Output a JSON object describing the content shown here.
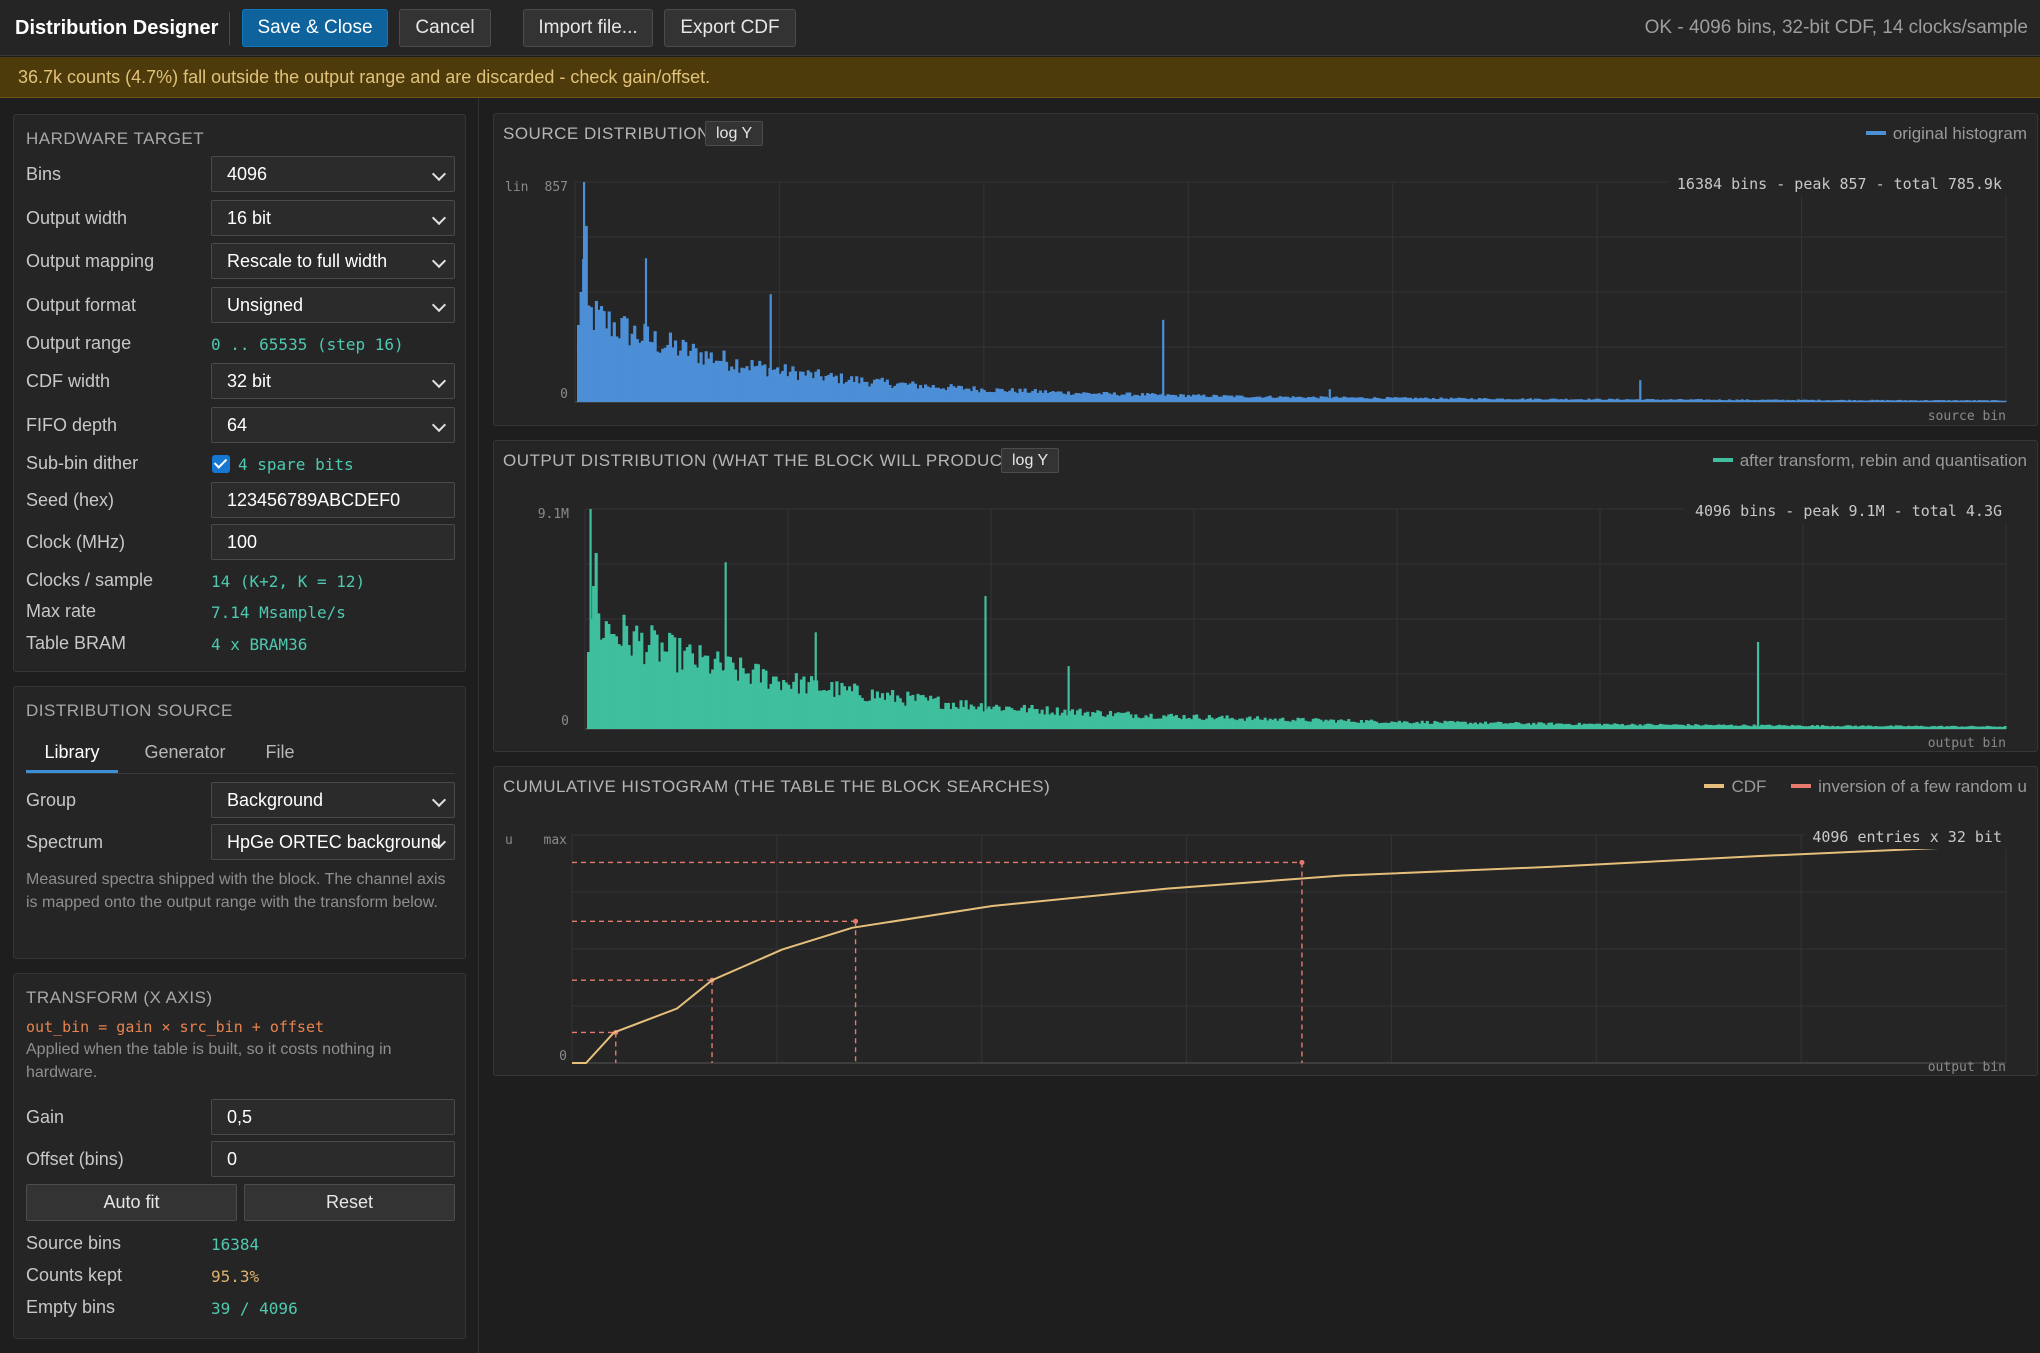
{
  "header": {
    "title": "Distribution Designer",
    "save_label": "Save & Close",
    "cancel_label": "Cancel",
    "import_label": "Import file...",
    "export_label": "Export CDF",
    "status": "OK - 4096 bins, 32-bit CDF, 14 clocks/sample"
  },
  "warning": "36.7k counts (4.7%) fall outside the output range and are discarded - check gain/offset.",
  "hardware": {
    "title": "HARDWARE TARGET",
    "bins_label": "Bins",
    "bins_value": "4096",
    "output_width_label": "Output width",
    "output_width_value": "16 bit",
    "output_mapping_label": "Output mapping",
    "output_mapping_value": "Rescale to full width",
    "output_format_label": "Output format",
    "output_format_value": "Unsigned",
    "output_range_label": "Output range",
    "output_range_value": "0 .. 65535 (step 16)",
    "cdf_width_label": "CDF width",
    "cdf_width_value": "32 bit",
    "fifo_label": "FIFO depth",
    "fifo_value": "64",
    "dither_label": "Sub-bin dither",
    "dither_value": "4 spare bits",
    "dither_checked": true,
    "seed_label": "Seed (hex)",
    "seed_value": "123456789ABCDEF0",
    "clock_label": "Clock (MHz)",
    "clock_value": "100",
    "clocks_label": "Clocks / sample",
    "clocks_value": "14 (K+2, K = 12)",
    "rate_label": "Max rate",
    "rate_value": "7.14 Msample/s",
    "bram_label": "Table BRAM",
    "bram_value": "4 x BRAM36"
  },
  "source": {
    "title": "DISTRIBUTION SOURCE",
    "tabs": [
      "Library",
      "Generator",
      "File"
    ],
    "active_tab": 0,
    "group_label": "Group",
    "group_value": "Background",
    "spectrum_label": "Spectrum",
    "spectrum_value": "HpGe ORTEC background",
    "description": "Measured spectra shipped with the block. The channel axis is mapped onto the output range with the transform below."
  },
  "transform": {
    "title": "TRANSFORM (X AXIS)",
    "formula": "out_bin = gain × src_bin + offset",
    "description": "Applied when the table is built, so it costs nothing in hardware.",
    "gain_label": "Gain",
    "gain_value": "0,5",
    "offset_label": "Offset (bins)",
    "offset_value": "0",
    "autofit_label": "Auto fit",
    "reset_label": "Reset",
    "source_bins_label": "Source bins",
    "source_bins_value": "16384",
    "counts_kept_label": "Counts kept",
    "counts_kept_value": "95.3%",
    "empty_bins_label": "Empty bins",
    "empty_bins_value": "39 / 4096"
  },
  "charts": {
    "source": {
      "title": "SOURCE DISTRIBUTION",
      "logy_label": "log Y",
      "legend": "original histogram",
      "color": "#4d8fd6",
      "scale_label": "lin",
      "y_max_label": "857",
      "y_min_label": "0",
      "info": "16384 bins - peak 857 - total 785.9k",
      "xlabel": "source bin"
    },
    "output": {
      "title": "OUTPUT DISTRIBUTION (WHAT THE BLOCK WILL PRODUCE)",
      "logy_label": "log Y",
      "legend": "after transform, rebin and quantisation",
      "color": "#3fbf9d",
      "scale_label": "lin",
      "y_max_label": "9.1M",
      "y_min_label": "0",
      "info": "4096 bins - peak 9.1M - total 4.3G",
      "xlabel": "output bin"
    },
    "cdf": {
      "title": "CUMULATIVE HISTOGRAM (THE TABLE THE BLOCK SEARCHES)",
      "legend_cdf": "CDF",
      "legend_inv": "inversion of a few random u",
      "cdf_color": "#e6c07b",
      "inv_color": "#e57b6e",
      "u_label": "u",
      "y_max_label": "max",
      "y_min_label": "0",
      "info": "4096 entries x 32 bit",
      "xlabel": "output bin"
    }
  },
  "chart_data": [
    {
      "type": "bar",
      "x_label": "source bin",
      "x_range": [
        0,
        16384
      ],
      "y_range": [
        0,
        857
      ],
      "peaks": [
        {
          "x": 80,
          "y": 857
        },
        {
          "x": 790,
          "y": 560
        },
        {
          "x": 2220,
          "y": 420
        },
        {
          "x": 6720,
          "y": 320
        },
        {
          "x": 8630,
          "y": 50
        },
        {
          "x": 12190,
          "y": 85
        }
      ]
    },
    {
      "type": "bar",
      "x_label": "output bin",
      "x_range": [
        0,
        4096
      ],
      "y_range": [
        0,
        9.1
      ],
      "peaks": [
        {
          "x": 10,
          "y": 9.1
        },
        {
          "x": 400,
          "y": 6.9
        },
        {
          "x": 660,
          "y": 4.0
        },
        {
          "x": 1150,
          "y": 5.5
        },
        {
          "x": 1390,
          "y": 2.6
        },
        {
          "x": 3380,
          "y": 3.6
        }
      ]
    },
    {
      "type": "line",
      "x_label": "output bin",
      "x_range": [
        0,
        4096
      ],
      "y_range": [
        0,
        1
      ],
      "cdf": [
        [
          0,
          0
        ],
        [
          40,
          0.0
        ],
        [
          120,
          0.14
        ],
        [
          300,
          0.25
        ],
        [
          400,
          0.38
        ],
        [
          600,
          0.52
        ],
        [
          800,
          0.62
        ],
        [
          1200,
          0.72
        ],
        [
          1700,
          0.8
        ],
        [
          2200,
          0.86
        ],
        [
          2800,
          0.9
        ],
        [
          3400,
          0.95
        ],
        [
          4096,
          1.0
        ]
      ],
      "inversions": [
        {
          "u": 0.14,
          "x": 125
        },
        {
          "u": 0.38,
          "x": 400
        },
        {
          "u": 0.65,
          "x": 810
        },
        {
          "u": 0.92,
          "x": 2085
        }
      ]
    }
  ]
}
